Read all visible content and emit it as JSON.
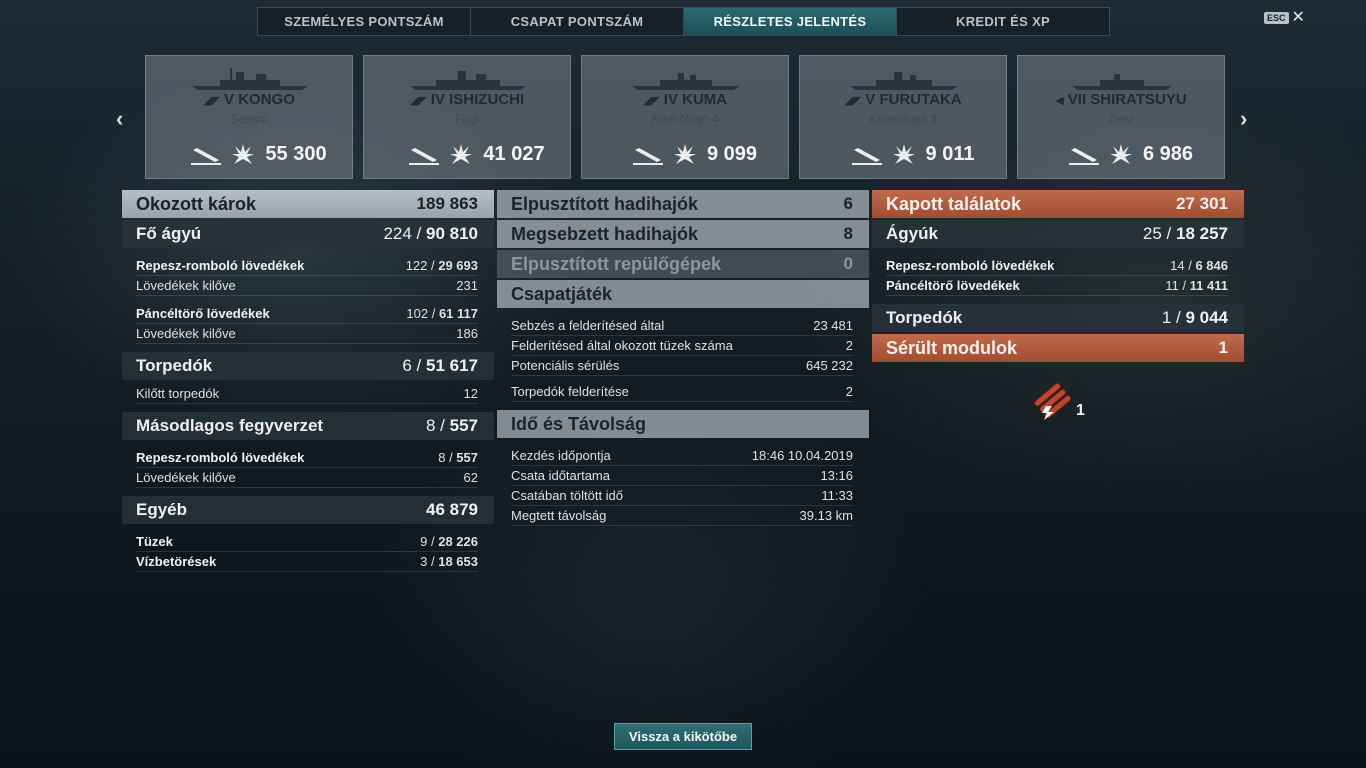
{
  "tabs": [
    "SZEMÉLYES PONTSZÁM",
    "CSAPAT PONTSZÁM",
    "RÉSZLETES JELENTÉS",
    "KREDIT ÉS XP"
  ],
  "active_tab": 2,
  "esc_label": "ESC",
  "ships": [
    {
      "name": "V KONGO",
      "player": "Senshi",
      "damage": "55 300",
      "class_icon": "battleship-icon"
    },
    {
      "name": "IV ISHIZUCHI",
      "player": "Fugi",
      "damage": "41 027",
      "class_icon": "battleship-icon"
    },
    {
      "name": "IV KUMA",
      "player": "Kísérőhajó 4",
      "damage": "9 099",
      "class_icon": "cruiser-icon"
    },
    {
      "name": "V FURUTAKA",
      "player": "Kísérőhajó 3",
      "damage": "9 011",
      "class_icon": "cruiser-icon"
    },
    {
      "name": "VII SHIRATSUYU",
      "player": "Daki",
      "damage": "6 986",
      "class_icon": "destroyer-icon"
    }
  ],
  "left": {
    "header": {
      "label": "Okozott károk",
      "value": "189 863"
    },
    "main_guns": {
      "label": "Fő ágyú",
      "a": "224",
      "b": "90 810"
    },
    "he": {
      "label": "Repesz-romboló lövedékek",
      "a": "122",
      "b": "29 693"
    },
    "he_fired": {
      "label": "Lövedékek kilőve",
      "value": "231"
    },
    "ap": {
      "label": "Páncéltörő lövedékek",
      "a": "102",
      "b": "61 117"
    },
    "ap_fired": {
      "label": "Lövedékek kilőve",
      "value": "186"
    },
    "torpedoes": {
      "label": "Torpedók",
      "a": "6",
      "b": "51 617"
    },
    "torp_fired": {
      "label": "Kilőtt torpedók",
      "value": "12"
    },
    "secondary": {
      "label": "Másodlagos fegyverzet",
      "a": "8",
      "b": "557"
    },
    "sec_he": {
      "label": "Repesz-romboló lövedékek",
      "a": "8",
      "b": "557"
    },
    "sec_fired": {
      "label": "Lövedékek kilőve",
      "value": "62"
    },
    "other": {
      "label": "Egyéb",
      "value": "46 879"
    },
    "fires": {
      "label": "Tüzek",
      "a": "9",
      "b": "28 226"
    },
    "flooding": {
      "label": "Vízbetörések",
      "a": "3",
      "b": "18 653"
    }
  },
  "middle": {
    "destroyed": {
      "label": "Elpusztított hadihajók",
      "value": "6"
    },
    "damaged": {
      "label": "Megsebzett hadihajók",
      "value": "8"
    },
    "planes": {
      "label": "Elpusztított repülőgépek",
      "value": "0"
    },
    "team": {
      "label": "Csapatjáték",
      "rows": [
        {
          "label": "Sebzés a felderítésed által",
          "value": "23 481"
        },
        {
          "label": "Felderítésed által okozott tüzek száma",
          "value": "2"
        },
        {
          "label": "Potenciális sérülés",
          "value": "645 232"
        },
        {
          "label": "Torpedók felderítése",
          "value": "2"
        }
      ]
    },
    "time": {
      "label": "Idő és Távolság",
      "rows": [
        {
          "label": "Kezdés időpontja",
          "value": "18:46  10.04.2019"
        },
        {
          "label": "Csata időtartama",
          "value": "13:16"
        },
        {
          "label": "Csatában töltött idő",
          "value": "11:33"
        },
        {
          "label": "Megtett távolság",
          "value": "39.13 km"
        }
      ]
    }
  },
  "right": {
    "header": {
      "label": "Kapott találatok",
      "value": "27 301"
    },
    "guns": {
      "label": "Ágyúk",
      "a": "25",
      "b": "18 257"
    },
    "he": {
      "label": "Repesz-romboló lövedékek",
      "a": "14",
      "b": "6 846"
    },
    "ap": {
      "label": "Páncéltörő lövedékek",
      "a": "11",
      "b": "11 411"
    },
    "torpedoes": {
      "label": "Torpedók",
      "a": "1",
      "b": "9 044"
    },
    "modules": {
      "label": "Sérült modulok",
      "value": "1"
    },
    "module_count": "1"
  },
  "back_button": "Vissza a kikötőbe",
  "colors": {
    "accent": "#2c6a72",
    "received": "#b35a3d",
    "panel": "#a9b2b8"
  }
}
